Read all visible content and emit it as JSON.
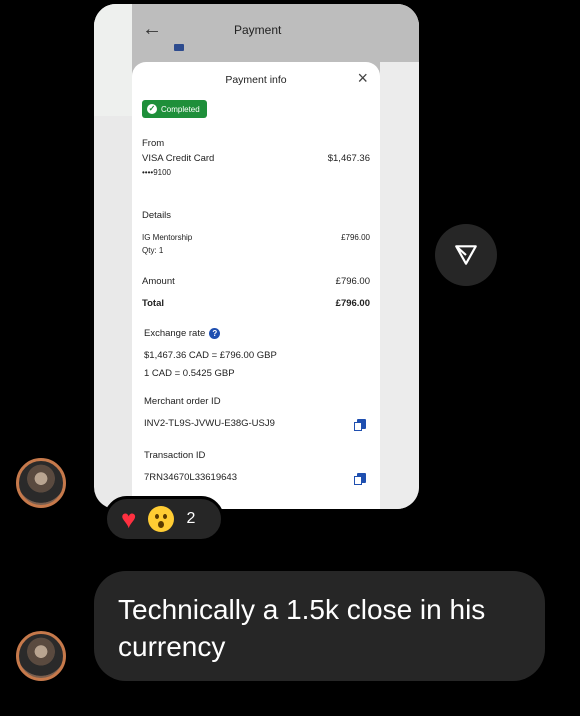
{
  "screenshot": {
    "header_title": "Payment",
    "sheet": {
      "title": "Payment info",
      "status": "Completed",
      "from_label": "From",
      "card_name": "VISA Credit Card",
      "card_number": "••••9100",
      "card_amount": "$1,467.36",
      "details_label": "Details",
      "item_name": "IG Mentorship",
      "item_qty": "Qty: 1",
      "item_amount": "£796.00",
      "amount_label": "Amount",
      "amount_value": "£796.00",
      "total_label": "Total",
      "total_value": "£796.00",
      "exchange_label": "Exchange rate",
      "exchange_line1": "$1,467.36 CAD = £796.00 GBP",
      "exchange_line2": "1 CAD = 0.5425 GBP",
      "merchant_label": "Merchant order ID",
      "merchant_id": "INV2-TL9S-JVWU-E38G-USJ9",
      "transaction_label": "Transaction ID",
      "transaction_id": "7RN34670L33619643"
    }
  },
  "reactions": {
    "count": "2"
  },
  "message": {
    "text": "Technically a 1.5k close in his currency"
  },
  "colors": {
    "background": "#000000",
    "bubble": "#262626",
    "completed": "#1e8f3a",
    "heart": "#ff3040"
  }
}
